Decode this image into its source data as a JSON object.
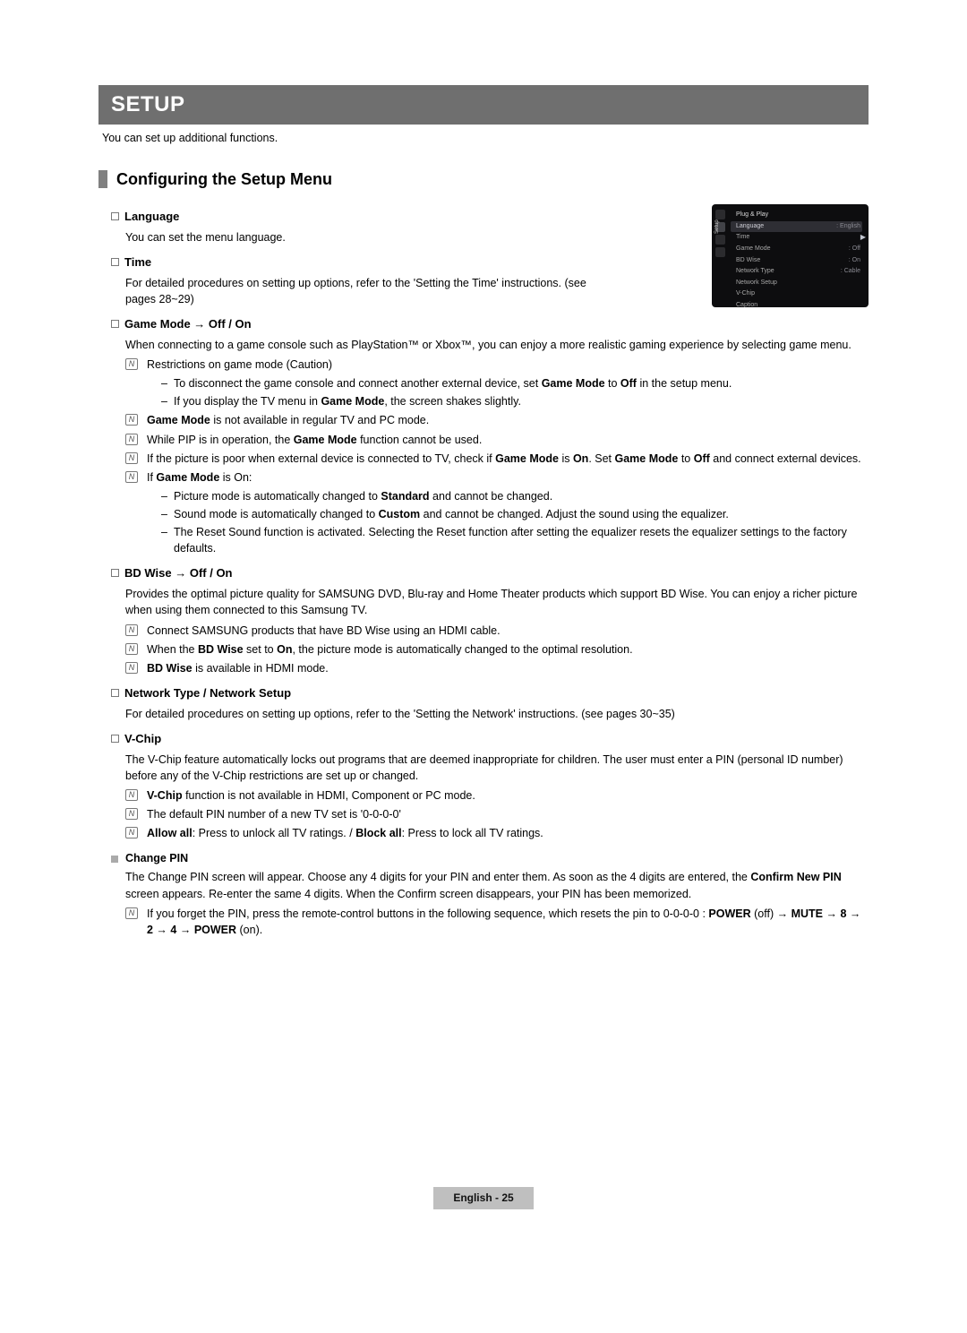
{
  "banner": "SETUP",
  "intro": "You can set up additional functions.",
  "section_heading": "Configuring the Setup Menu",
  "language": {
    "title": "Language",
    "body": "You can set the menu language."
  },
  "time": {
    "title": "Time",
    "body": "For detailed procedures on setting up options, refer to the 'Setting the Time' instructions. (see pages 28~29)"
  },
  "game": {
    "title": "Game Mode → Off / On",
    "body": "When connecting to a game console such as PlayStation™ or Xbox™, you can enjoy a more realistic gaming experience by selecting game menu.",
    "n1": "Restrictions on game mode (Caution)",
    "d1a": "To disconnect the game console and connect another external device, set ",
    "d1b": "Game Mode",
    "d1c": " to ",
    "d1d": "Off",
    "d1e": " in the setup menu.",
    "d2a": "If you display the TV menu in ",
    "d2b": "Game Mode",
    "d2c": ", the screen shakes slightly.",
    "n2a": "Game Mode",
    "n2b": " is not available in regular TV and PC mode.",
    "n3a": "While PIP is in operation, the ",
    "n3b": "Game Mode",
    "n3c": " function cannot be used.",
    "n4a": "If the picture is poor when external device is connected to TV, check if ",
    "n4b": "Game Mode",
    "n4c": " is ",
    "n4d": "On",
    "n4e": ". Set ",
    "n4f": "Game Mode",
    "n4g": " to ",
    "n4h": "Off",
    "n4i": " and connect external devices.",
    "n5a": "If ",
    "n5b": "Game Mode",
    "n5c": " is On:",
    "d3a": "Picture mode is automatically changed to ",
    "d3b": "Standard",
    "d3c": " and cannot be changed.",
    "d4a": "Sound mode is automatically changed to ",
    "d4b": "Custom",
    "d4c": " and cannot be changed. Adjust the sound using the equalizer.",
    "d5": "The Reset Sound function is activated. Selecting the Reset function after setting the equalizer resets the equalizer settings to the factory defaults."
  },
  "bdwise": {
    "title": "BD Wise → Off / On",
    "body": "Provides the optimal picture quality for SAMSUNG DVD, Blu-ray and Home Theater products which support BD Wise. You can enjoy a richer picture when using them connected to this Samsung TV.",
    "n1": "Connect SAMSUNG products that have BD Wise using an HDMI cable.",
    "n2a": "When the ",
    "n2b": "BD Wise",
    "n2c": " set to ",
    "n2d": "On",
    "n2e": ", the picture mode is automatically changed to the optimal resolution.",
    "n3a": "BD Wise",
    "n3b": " is available in HDMI mode."
  },
  "network": {
    "title": "Network Type / Network Setup",
    "body": "For detailed procedures on setting up options, refer to the 'Setting the Network' instructions. (see pages 30~35)"
  },
  "vchip": {
    "title": "V-Chip",
    "body": "The V-Chip feature automatically locks out programs that are deemed inappropriate for children. The user must enter a PIN (personal ID number) before any of the V-Chip restrictions are set up or changed.",
    "n1a": "V-Chip",
    "n1b": " function is not available in HDMI, Component or PC mode.",
    "n2": "The default PIN number of a new TV set is '0-0-0-0'",
    "n3a": "Allow all",
    "n3b": ": Press to unlock all TV ratings. / ",
    "n3c": "Block all",
    "n3d": ": Press to lock all TV ratings."
  },
  "changepin": {
    "title": "Change PIN",
    "body_a": "The Change PIN screen will appear. Choose any 4 digits for your PIN and enter them. As soon as the 4 digits are entered, the ",
    "body_b": "Confirm New PIN",
    "body_c": " screen appears. Re-enter the same 4 digits. When the Confirm screen disappears, your PIN has been memorized.",
    "n1a": "If you forget the PIN, press the remote-control buttons in the following sequence, which resets the pin to 0-0-0-0 : ",
    "n1b": "POWER",
    "n1c": " (off) → ",
    "n1d": "MUTE",
    "n1e": " → ",
    "n1f": "8",
    "n1g": " → ",
    "n1h": "2",
    "n1i": " → ",
    "n1j": "4",
    "n1k": " → ",
    "n1l": "POWER",
    "n1m": " (on)."
  },
  "osd": {
    "side_label": "Setup",
    "r1": "Plug & Play",
    "r2k": "Language",
    "r2v": ": English",
    "r3k": "Time",
    "r4k": "Game Mode",
    "r4v": ": Off",
    "r5k": "BD Wise",
    "r5v": ": On",
    "r6k": "Network Type",
    "r6v": ": Cable",
    "r7k": "Network Setup",
    "r8k": "V-Chip",
    "r9k": "Caption"
  },
  "footer": "English - 25"
}
